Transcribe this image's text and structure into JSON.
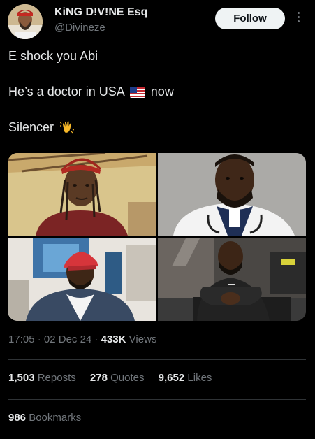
{
  "author": {
    "name": "KiNG D!V!NE Esq",
    "handle": "@Divineze"
  },
  "follow_label": "Follow",
  "tweet": {
    "line1": "E shock you Abi",
    "line2_before": "He’s a doctor in USA",
    "line2_after": "now",
    "line3": "Silencer"
  },
  "meta": {
    "time": "17:05",
    "date": "02 Dec 24",
    "views_count": "433K",
    "views_label": "Views"
  },
  "stats": {
    "reposts_count": "1,503",
    "reposts_label": "Reposts",
    "quotes_count": "278",
    "quotes_label": "Quotes",
    "likes_count": "9,652",
    "likes_label": "Likes",
    "bookmarks_count": "986",
    "bookmarks_label": "Bookmarks"
  },
  "icons": [
    "avatar-photo",
    "more-options-icon",
    "us-flag-emoji",
    "waving-hand-emoji"
  ],
  "colors": {
    "background": "#000000",
    "text_primary": "#e7e9ea",
    "text_secondary": "#71767b",
    "follow_bg": "#eff3f4",
    "divider": "#2f3336"
  }
}
